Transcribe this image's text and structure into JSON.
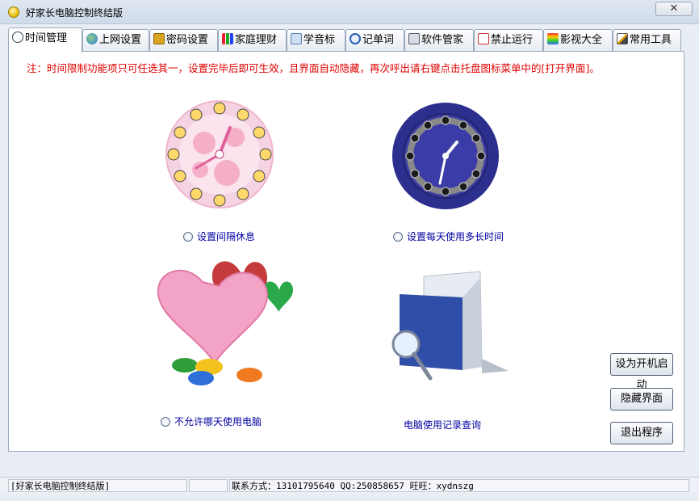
{
  "window": {
    "title": "好家长电脑控制终结版",
    "close_label": "✕"
  },
  "tabs": [
    {
      "label": "时间管理"
    },
    {
      "label": "上网设置"
    },
    {
      "label": "密码设置"
    },
    {
      "label": "家庭理财"
    },
    {
      "label": "学音标"
    },
    {
      "label": "记单词"
    },
    {
      "label": "软件管家"
    },
    {
      "label": "禁止运行"
    },
    {
      "label": "影视大全"
    },
    {
      "label": "常用工具"
    }
  ],
  "notice": "注：时间限制功能项只可任选其一，设置完毕后即可生效，且界面自动隐藏，再次呼出请右键点击托盘图标菜单中的[打开界面]。",
  "options": {
    "interval_rest": "设置间隔休息",
    "daily_limit": "设置每天使用多长时间",
    "disallow_day": "不允许哪天使用电脑",
    "usage_log": "电脑使用记录查询"
  },
  "buttons": {
    "autostart": "设为开机启动",
    "hide": "隐藏界面",
    "exit": "退出程序"
  },
  "status": {
    "app": "[好家长电脑控制终结版]",
    "contact": "联系方式：13101795640    QQ:250858657    旺旺：xydnszg"
  },
  "colors": {
    "notice": "#e00000",
    "link": "#0000a0"
  }
}
